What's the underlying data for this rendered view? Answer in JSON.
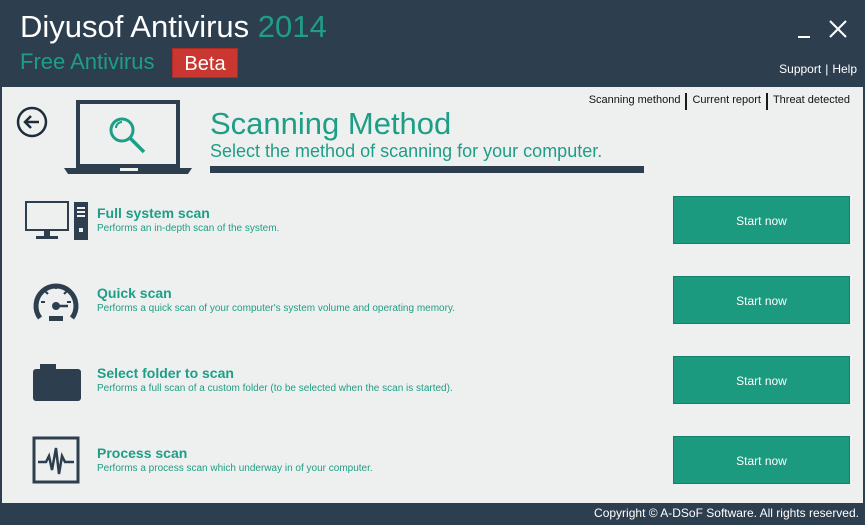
{
  "app": {
    "title_main": "Diyusof Antivirus",
    "title_year": "2014",
    "subtitle": "Free Antivirus",
    "beta_label": "Beta"
  },
  "window_controls": {
    "minimize_icon": "minimize-icon",
    "close_icon": "close-icon"
  },
  "header_links": {
    "support": "Support",
    "separator": "|",
    "help": "Help"
  },
  "top_tabs": [
    {
      "label": "Scanning methond"
    },
    {
      "label": "Current report"
    },
    {
      "label": "Threat detected"
    }
  ],
  "page": {
    "title": "Scanning Method",
    "subtitle": "Select the method of scanning for your computer."
  },
  "scans": [
    {
      "icon": "desktop-computer-icon",
      "title": "Full system scan",
      "description": "Performs an in-depth scan of the system.",
      "button": "Start now"
    },
    {
      "icon": "speedometer-icon",
      "title": "Quick scan",
      "description": "Performs a quick scan of your computer's system volume and operating memory.",
      "button": "Start now"
    },
    {
      "icon": "folder-icon",
      "title": "Select folder to scan",
      "description": "Performs a full scan of a custom folder (to be selected when the scan is started).",
      "button": "Start now"
    },
    {
      "icon": "pulse-monitor-icon",
      "title": "Process scan",
      "description": "Performs a process scan which underway in of your computer.",
      "button": "Start now"
    }
  ],
  "footer": {
    "copyright": "Copyright © A-DSoF Software. All rights reserved."
  },
  "colors": {
    "header_bg": "#2d3e4f",
    "accent_green": "#1e9e86",
    "button_green": "#1c9a7f",
    "beta_red": "#c93730",
    "content_bg": "#eef0f0"
  }
}
